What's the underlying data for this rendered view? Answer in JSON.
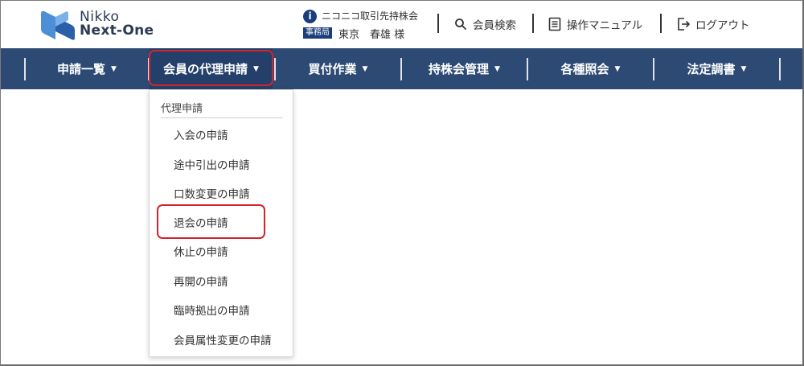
{
  "header": {
    "logo": {
      "line1": "Nikko",
      "line2": "Next-One"
    },
    "account": {
      "info_icon": "info-icon",
      "company": "ニコニコ取引先持株会",
      "office_badge": "事務局",
      "user_name": "東京　春雄 様"
    },
    "links": {
      "member_search": "会員検索",
      "manual": "操作マニュアル",
      "logout": "ログアウト"
    }
  },
  "nav": {
    "items": [
      {
        "label": "申請一覧"
      },
      {
        "label": "会員の代理申請"
      },
      {
        "label": "買付作業"
      },
      {
        "label": "持株会管理"
      },
      {
        "label": "各種照会"
      },
      {
        "label": "法定調書"
      }
    ],
    "active": "会員の代理申請"
  },
  "dropdown": {
    "header": "代理申請",
    "items": [
      "入会の申請",
      "途中引出の申請",
      "口数変更の申請",
      "退会の申請",
      "休止の申請",
      "再開の申請",
      "臨時拠出の申請",
      "会員属性変更の申請"
    ],
    "highlighted": "退会の申請"
  },
  "colors": {
    "nav_bg": "#2c4a73",
    "brand_blue": "#1a3d7c",
    "highlight_red": "#d1252a"
  }
}
